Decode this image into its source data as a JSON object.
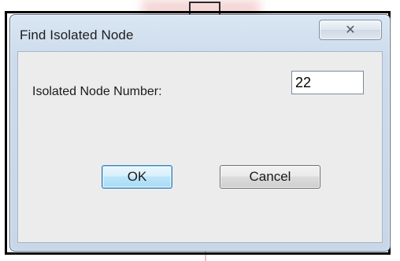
{
  "window": {
    "title": "Find Isolated Node",
    "close_glyph": "✕"
  },
  "form": {
    "label": "Isolated Node Number:",
    "value": "22"
  },
  "buttons": {
    "ok_label": "OK",
    "cancel_label": "Cancel"
  },
  "colors": {
    "ok_accent": "#3c7fb1",
    "frame": "#c7d7e8",
    "client_bg": "#ececec"
  },
  "icons": {
    "close": "close-icon"
  }
}
